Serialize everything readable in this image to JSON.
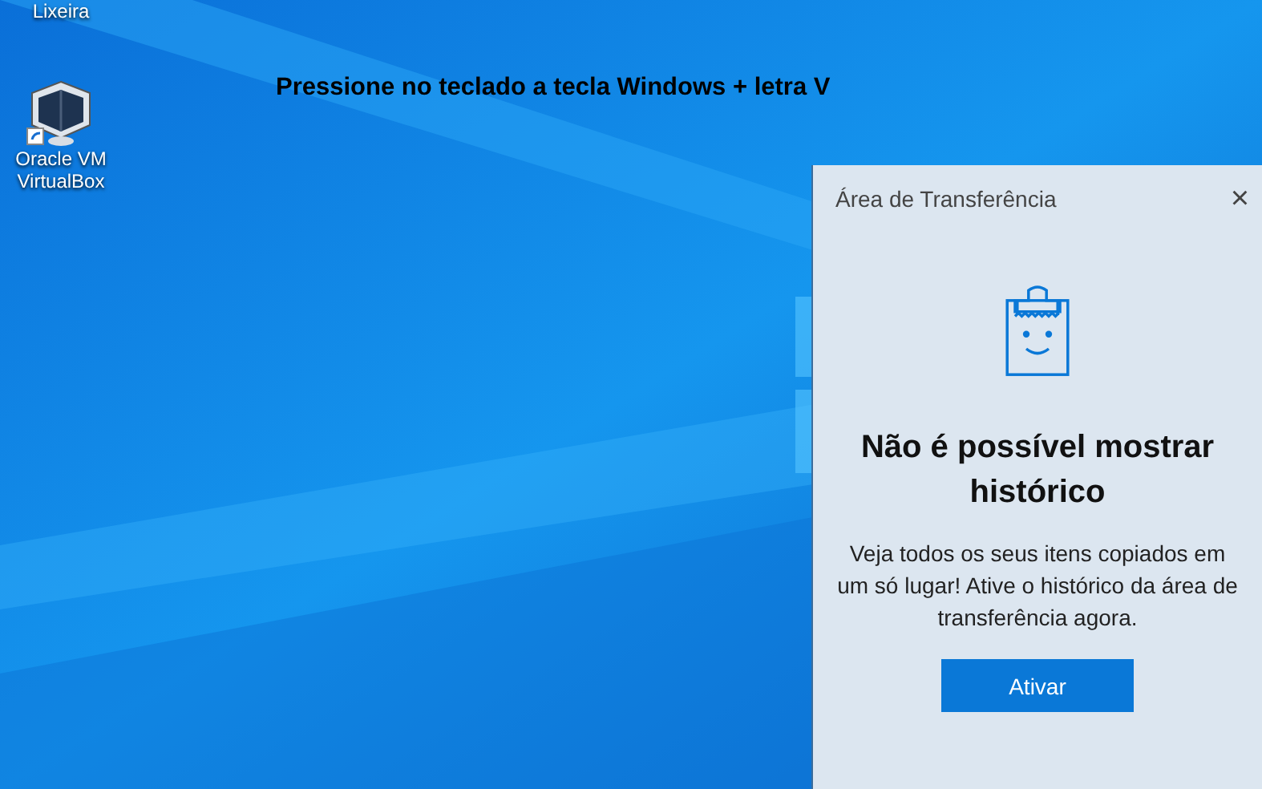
{
  "desktop": {
    "icons": [
      {
        "label": "Lixeira"
      },
      {
        "label": "Oracle VM VirtualBox"
      }
    ],
    "annotation": "Pressione no teclado a tecla Windows + letra V"
  },
  "clipboard_panel": {
    "title": "Área de Transferência",
    "close": "×",
    "heading": "Não é possível mostrar histórico",
    "message": "Veja todos os seus itens copiados em um só lugar! Ative o histórico da área de transferência agora.",
    "button": "Ativar"
  }
}
